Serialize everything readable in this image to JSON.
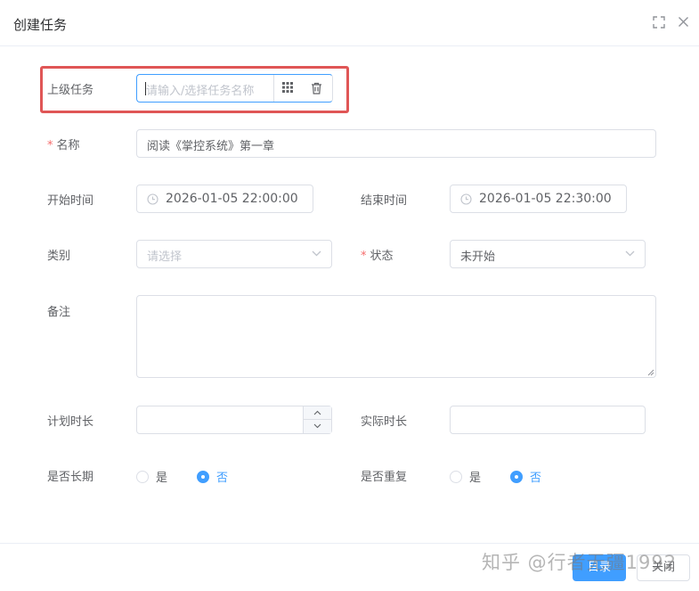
{
  "dialog": {
    "title": "创建任务",
    "maximize_icon": "fullscreen-icon",
    "close_icon": "close-icon"
  },
  "form": {
    "parent_task": {
      "label": "上级任务",
      "placeholder": "请输入/选择任务名称",
      "value": "",
      "select_icon": "grid-icon",
      "clear_icon": "trash-icon"
    },
    "name": {
      "required": "*",
      "label": "名称",
      "value": "阅读《掌控系统》第一章"
    },
    "start_time": {
      "label": "开始时间",
      "value": "2026-01-05 22:00:00",
      "icon": "clock-icon"
    },
    "end_time": {
      "label": "结束时间",
      "value": "2026-01-05 22:30:00",
      "icon": "clock-icon"
    },
    "category": {
      "label": "类别",
      "placeholder": "请选择",
      "value": ""
    },
    "status": {
      "required": "*",
      "label": "状态",
      "value": "未开始"
    },
    "remark": {
      "label": "备注",
      "value": ""
    },
    "planned_duration": {
      "label": "计划时长",
      "value": ""
    },
    "actual_duration": {
      "label": "实际时长",
      "value": ""
    },
    "is_long_term": {
      "label": "是否长期",
      "options": [
        "是",
        "否"
      ],
      "selected": "否"
    },
    "is_repeat": {
      "label": "是否重复",
      "options": [
        "是",
        "否"
      ],
      "selected": "否"
    }
  },
  "footer": {
    "confirm_label": "目录",
    "cancel_label": "关闭"
  },
  "watermark": "知乎 @行者无疆1992",
  "colors": {
    "primary": "#409eff",
    "highlight_border": "#e05656",
    "required": "#f56c6c"
  }
}
